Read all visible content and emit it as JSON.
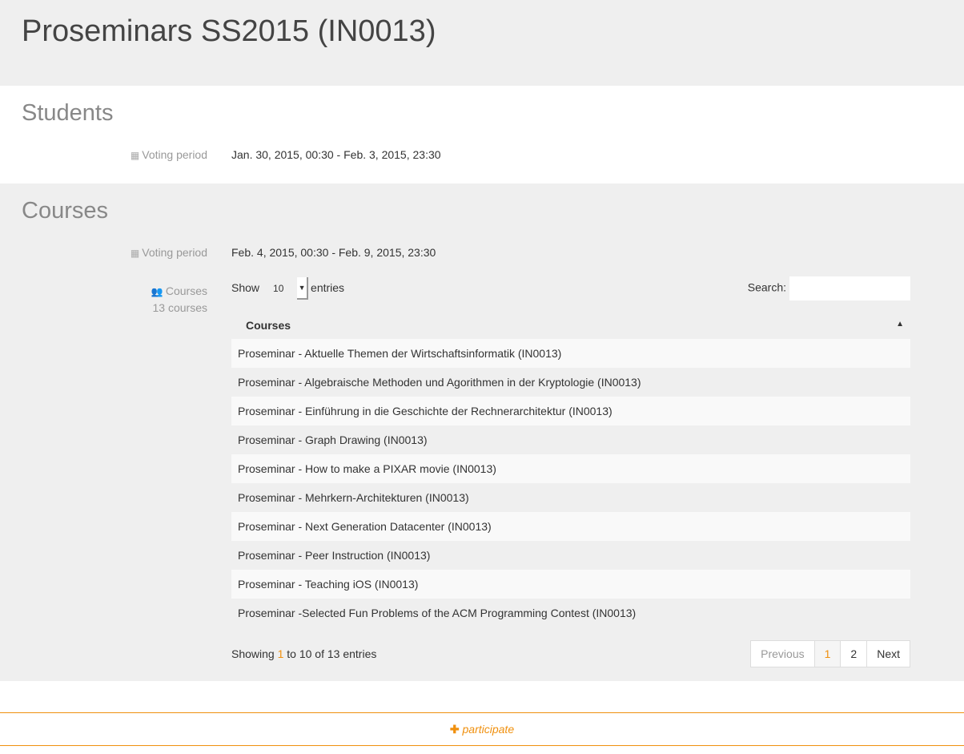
{
  "header": {
    "title": "Proseminars SS2015 (IN0013)"
  },
  "students": {
    "title": "Students",
    "voting_label": "Voting period",
    "voting_value": "Jan. 30, 2015, 00:30 - Feb. 3, 2015, 23:30"
  },
  "courses": {
    "title": "Courses",
    "voting_label": "Voting period",
    "voting_value": "Feb. 4, 2015, 00:30 - Feb. 9, 2015, 23:30",
    "courses_label": "Courses",
    "courses_count": "13 courses",
    "show_label": "Show",
    "page_size": "10",
    "entries_label": "entries",
    "search_label": "Search:",
    "search_value": "",
    "column": "Courses",
    "rows": [
      "Proseminar - Aktuelle Themen der Wirtschaftsinformatik (IN0013)",
      "Proseminar - Algebraische Methoden und Agorithmen in der Kryptologie (IN0013)",
      "Proseminar - Einführung in die Geschichte der Rechnerarchitektur (IN0013)",
      "Proseminar - Graph Drawing (IN0013)",
      "Proseminar - How to make a PIXAR movie (IN0013)",
      "Proseminar - Mehrkern-Architekturen (IN0013)",
      "Proseminar - Next Generation Datacenter (IN0013)",
      "Proseminar - Peer Instruction (IN0013)",
      "Proseminar - Teaching iOS (IN0013)",
      "Proseminar -Selected Fun Problems of the ACM Programming Contest (IN0013)"
    ],
    "info": {
      "pre": "Showing ",
      "start": "1",
      "mid": " to 10 of 13 entries"
    },
    "pager": {
      "previous": "Previous",
      "p1": "1",
      "p2": "2",
      "next": "Next"
    }
  },
  "participate": "participate",
  "accent": "#f0900e"
}
